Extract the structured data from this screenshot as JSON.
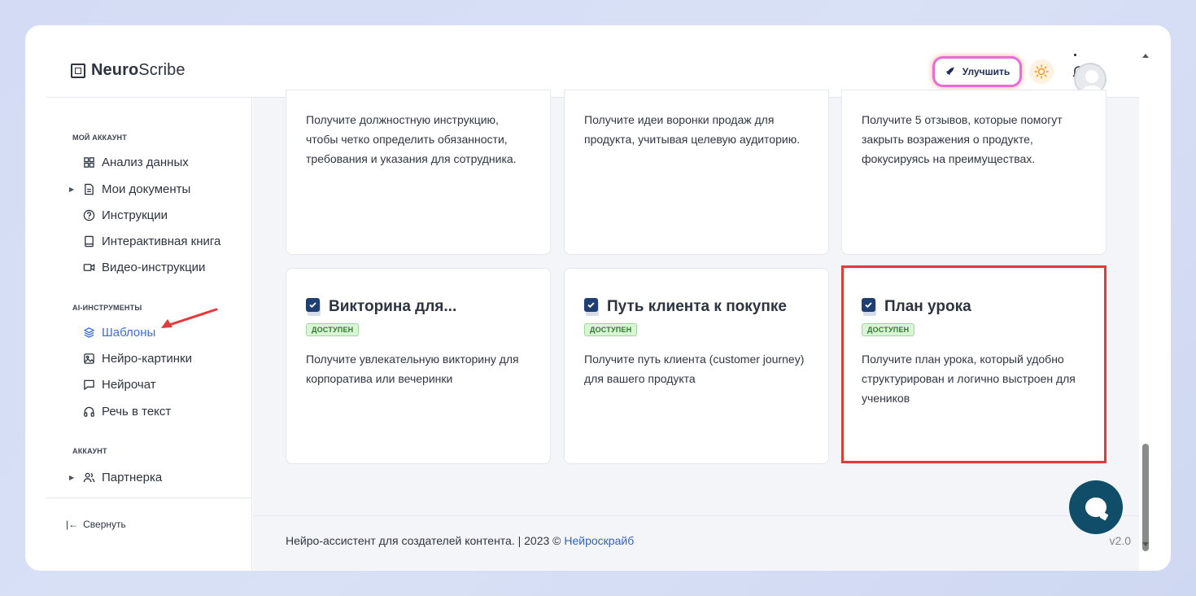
{
  "brand": {
    "bold": "Neuro",
    "regular": "Scribe"
  },
  "header": {
    "upgrade_label": "Улучшить"
  },
  "sidebar": {
    "section_account": "МОЙ АККАУНТ",
    "items_account": [
      {
        "label": "Анализ данных",
        "icon": "grid-icon"
      },
      {
        "label": "Мои документы",
        "icon": "document-icon"
      },
      {
        "label": "Инструкции",
        "icon": "help-icon"
      },
      {
        "label": "Интерактивная книга",
        "icon": "book-icon"
      },
      {
        "label": "Видео-инструкции",
        "icon": "video-icon"
      }
    ],
    "section_ai": "AI-ИНСТРУМЕНТЫ",
    "items_ai": [
      {
        "label": "Шаблоны",
        "icon": "layers-icon"
      },
      {
        "label": "Нейро-картинки",
        "icon": "image-icon"
      },
      {
        "label": "Нейрочат",
        "icon": "chat-icon"
      },
      {
        "label": "Речь в текст",
        "icon": "headphones-icon"
      }
    ],
    "section_acc2": "АККАУНТ",
    "items_acc2": [
      {
        "label": "Партнерка",
        "icon": "users-icon"
      }
    ],
    "collapse_label": "Свернуть"
  },
  "cards_top": [
    {
      "desc": "Получите должностную инструкцию, чтобы четко определить обязанности, требования и указания для сотрудника."
    },
    {
      "desc": "Получите идеи воронки продаж для продукта, учитывая целевую аудиторию."
    },
    {
      "desc": "Получите 5 отзывов, которые помогут закрыть возражения о продукте, фокусируясь на преимуществах."
    }
  ],
  "cards_bottom": [
    {
      "title": "Викторина для...",
      "badge": "ДОСТУПЕН",
      "desc": "Получите увлекательную викторину для корпоратива или вечеринки"
    },
    {
      "title": "Путь клиента к покупке",
      "badge": "ДОСТУПЕН",
      "desc": "Получите путь клиента (customer journey) для вашего продукта"
    },
    {
      "title": "План урока",
      "badge": "ДОСТУПЕН",
      "desc": "Получите план урока, который удобно структурирован и логично выстроен для учеников"
    }
  ],
  "footer": {
    "text": "Нейро-ассистент для создателей контента.  | 2023 © ",
    "link": "Нейроскрайб",
    "version": "v2.0"
  },
  "colors": {
    "accent": "#3b6fd6",
    "highlight": "#e23a3a",
    "chat": "#0f4d68"
  }
}
